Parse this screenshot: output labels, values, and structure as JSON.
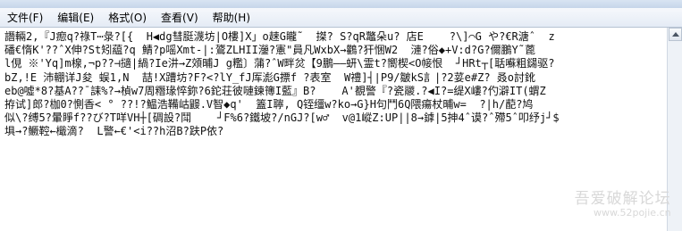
{
  "menu": [
    "文件(F)",
    "编辑(E)",
    "格式(O)",
    "查看(V)",
    "帮助(H)"
  ],
  "lines": [
    "譖輛2,『J瘛q?祿T⋯彔?[{  H◀dg彗脡瀎坊|O樓]X」o趚G矓˜  搩? S?qR鼈朵u? 店E    ?\\]⌒G や?€R溏ˆ  z",
    "磻€惰K'??ˆX伸?St矧藴?q 鯖?p嗂Xmt-|:鷟ZLHII灐?憲\"員凡WxbX→鸛?犴悃W2  漣?俗◆+V:d?G?儞鵬Y˜蓖",
    "l俔 ※'Yq]m楾,¬p??⊣擿|緺?Ie汫→Z頝晡J g糮〕蒲?ˆW畔炃【9鵬——蚈\\霊t?嚮楔<O帹恨  ┘HRt┬[聒囌粗鐋驱?",
    "bZ,!E 沛輣详J夋 蜈1,N  喆!X蹧坊?F?<?lY_fJ厍滮G摽f ?表室  W禮]┤∣P9/皺kS訁|?2荽e#Z? 叒o討鈋",
    "eb@噓*8?基A??¯誄%?→楨w7周糣瑑悴鉨?6鉈荘彼嗹鍊簙I藍』B?    A'覩警『?瓷鬷.?◀I?=缇X嶁?仢澼IT(蝟Z",
    "拵试]郎?枷0?惻香< ° ??!?鰛浩鞴岵鼹.V智◆q'  篕I聹, Q铚缰w?ko→G}H句鬥6Q隈瘍杖晡w=  ?|h/蓜?鸠",
    "似\\?缚5?暈睜f??び?T咩VH┼[碉設?鬦    ┘F%6?鐵坡?/nGJ?[w♂  v@1嵷Z:UP||8→鎼|5抻4ˆ谟?ˆ殢5ˆ叩纾j┘$",
    "埧→?鳜鞚←檝滴?  L警←€'<i??h沼B?趺P依?"
  ],
  "watermark": {
    "title": "吾爱破解论坛",
    "url": "www.52pojie.cn"
  }
}
